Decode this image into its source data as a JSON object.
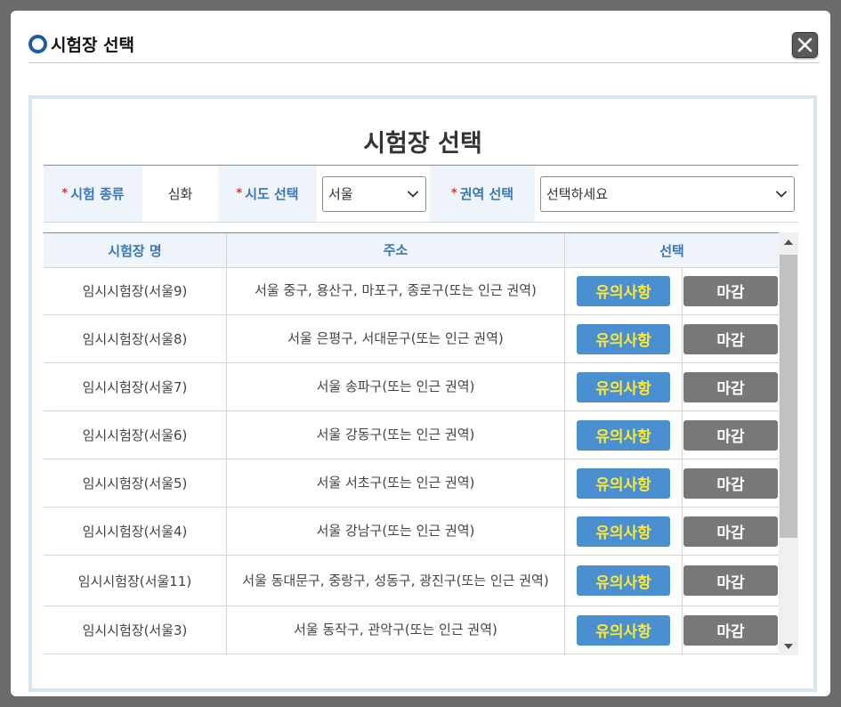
{
  "dialog": {
    "title": "시험장 선택"
  },
  "panel": {
    "title": "시험장 선택"
  },
  "filters": {
    "exam_type_label": "시험 종류",
    "exam_type_value": "심화",
    "region_label": "시도 선택",
    "region_value": "서울",
    "area_label": "권역 선택",
    "area_value": "선택하세요",
    "required_mark": "*"
  },
  "table": {
    "headers": [
      "시험장 명",
      "주소",
      "선택"
    ],
    "rows": [
      {
        "name": "임시시험장(서울9)",
        "address": "서울 중구, 용산구, 마포구, 종로구(또는 인근 권역)",
        "note_btn": "유의사항",
        "status_btn": "마감"
      },
      {
        "name": "임시시험장(서울8)",
        "address": "서울 은평구, 서대문구(또는 인근 권역)",
        "note_btn": "유의사항",
        "status_btn": "마감"
      },
      {
        "name": "임시시험장(서울7)",
        "address": "서울 송파구(또는 인근 권역)",
        "note_btn": "유의사항",
        "status_btn": "마감"
      },
      {
        "name": "임시시험장(서울6)",
        "address": "서울 강동구(또는 인근 권역)",
        "note_btn": "유의사항",
        "status_btn": "마감"
      },
      {
        "name": "임시시험장(서울5)",
        "address": "서울 서초구(또는 인근 권역)",
        "note_btn": "유의사항",
        "status_btn": "마감"
      },
      {
        "name": "임시시험장(서울4)",
        "address": "서울 강남구(또는 인근 권역)",
        "note_btn": "유의사항",
        "status_btn": "마감"
      },
      {
        "name": "임시시험장(서울11)",
        "address": "서울 동대문구, 중랑구, 성동구, 광진구(또는 인근 권역)",
        "note_btn": "유의사항",
        "status_btn": "마감"
      },
      {
        "name": "임시시험장(서울3)",
        "address": "서울 동작구, 관악구(또는 인근 권역)",
        "note_btn": "유의사항",
        "status_btn": "마감"
      }
    ]
  },
  "icons": {
    "title": "ring-icon",
    "close": "close-icon",
    "dropdown": "chevron-down-icon",
    "scroll_up": "arrow-up-icon",
    "scroll_down": "arrow-down-icon"
  },
  "colors": {
    "accent": "#1e5aa8",
    "label_text": "#3a76b8",
    "note_button": "#4a8fd0",
    "note_text": "#ffe933",
    "closed_button": "#787878",
    "required_star": "#e0322c"
  }
}
